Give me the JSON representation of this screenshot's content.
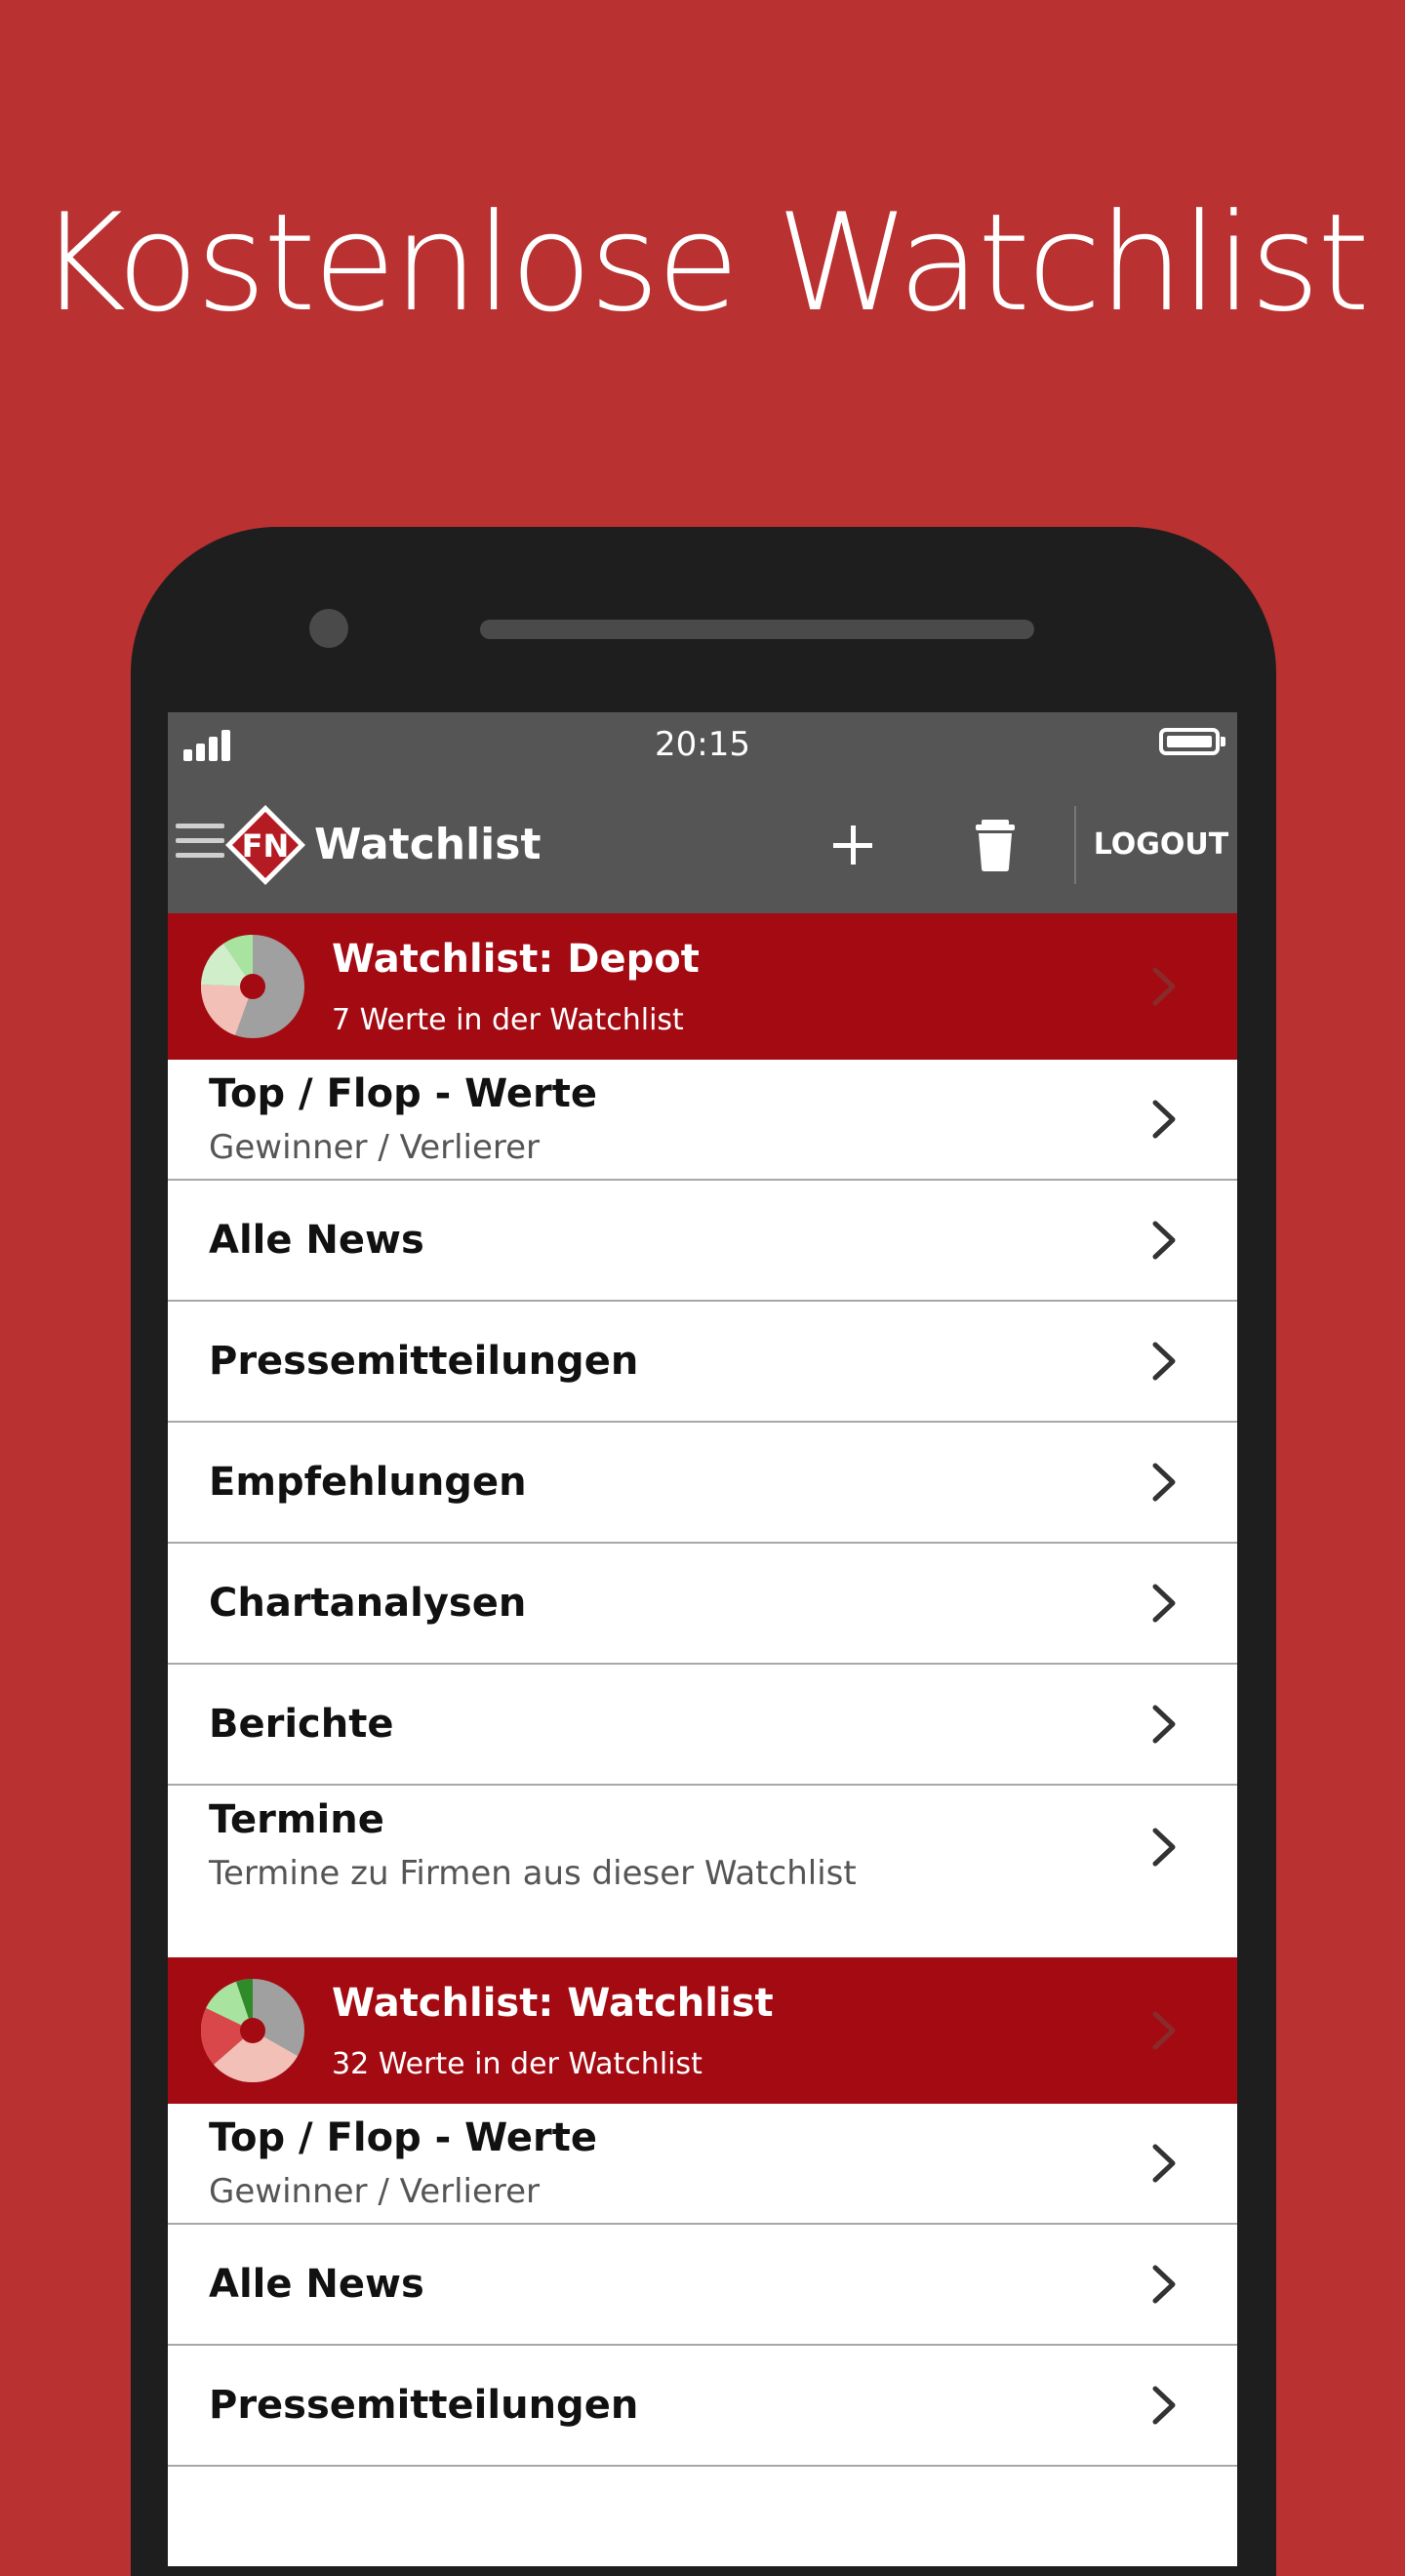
{
  "headline": "Kostenlose Watchlist",
  "status_bar": {
    "time": "20:15"
  },
  "app_bar": {
    "title": "Watchlist",
    "logo_text": "FN",
    "logout_label": "LOGOUT"
  },
  "icons": {
    "menu": "menu-icon",
    "add": "plus-icon",
    "delete": "trash-icon",
    "chevron": "chevron-right-icon",
    "signal": "signal-icon",
    "battery": "battery-icon"
  },
  "colors": {
    "background": "#b93131",
    "watchlist_header": "#a30a12",
    "app_bar": "#555555",
    "phone": "#1e1e1e"
  },
  "watchlists": [
    {
      "name": "Watchlist: Depot",
      "count": "7 Werte in der Watchlist",
      "items": [
        {
          "title": "Top / Flop - Werte",
          "subtitle": "Gewinner / Verlierer"
        },
        {
          "title": "Alle News"
        },
        {
          "title": "Pressemitteilungen"
        },
        {
          "title": "Empfehlungen"
        },
        {
          "title": "Chartanalysen"
        },
        {
          "title": "Berichte"
        },
        {
          "title": "Termine",
          "subtitle": "Termine zu Firmen aus dieser Watchlist"
        }
      ]
    },
    {
      "name": "Watchlist: Watchlist",
      "count": "32 Werte in der Watchlist",
      "items": [
        {
          "title": "Top / Flop - Werte",
          "subtitle": "Gewinner / Verlierer"
        },
        {
          "title": "Alle News"
        },
        {
          "title": "Pressemitteilungen"
        }
      ]
    }
  ]
}
